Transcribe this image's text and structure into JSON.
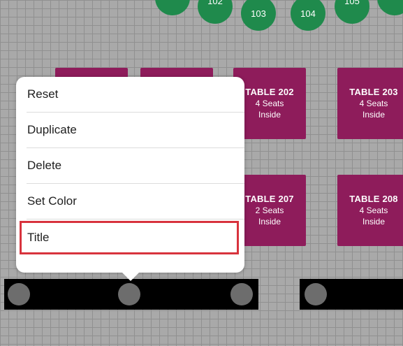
{
  "round_tables": [
    {
      "label": "",
      "id": "round-1"
    },
    {
      "label": "102",
      "id": "round-102"
    },
    {
      "label": "103",
      "id": "round-103"
    },
    {
      "label": "104",
      "id": "round-104"
    },
    {
      "label": "105",
      "id": "round-105"
    },
    {
      "label": "",
      "id": "round-6"
    }
  ],
  "tables": {
    "t202": {
      "title": "TABLE 202",
      "seats": "4 Seats",
      "location": "Inside"
    },
    "t203": {
      "title": "TABLE 203",
      "seats": "4 Seats",
      "location": "Inside"
    },
    "t207": {
      "title": "TABLE 207",
      "seats": "2 Seats",
      "location": "Inside"
    },
    "t208": {
      "title": "TABLE 208",
      "seats": "4 Seats",
      "location": "Inside"
    }
  },
  "menu": {
    "items": [
      "Reset",
      "Duplicate",
      "Delete",
      "Set Color",
      "Title"
    ],
    "highlighted": "Title"
  },
  "colors": {
    "round_table": "#1f8a4c",
    "square_table": "#8e1c5b",
    "highlight": "#d8333d",
    "bench": "#000000"
  }
}
